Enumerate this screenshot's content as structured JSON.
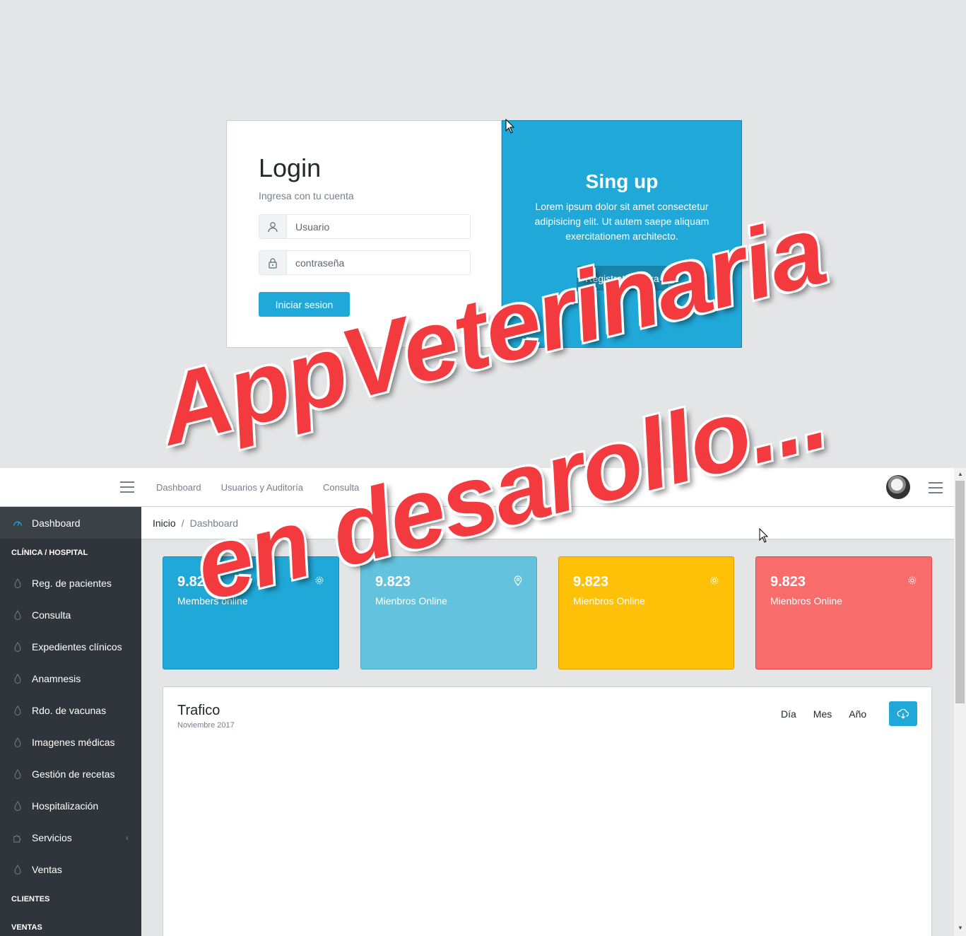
{
  "login": {
    "title": "Login",
    "subtitle": "Ingresa con tu cuenta",
    "username_placeholder": "Usuario",
    "password_placeholder": "contraseña",
    "submit_label": "Iniciar sesion",
    "user_icon": "user-icon",
    "lock_icon": "lock-icon"
  },
  "signup": {
    "title": "Sing up",
    "text": "Lorem ipsum dolor sit amet consectetur adipisicing elit. Ut autem saepe aliquam exercitationem architecto.",
    "button_label": "Registrate Ahora"
  },
  "header": {
    "nav": [
      "Dashboard",
      "Usuarios y Auditoría",
      "Consulta"
    ]
  },
  "sidebar": {
    "items": [
      {
        "type": "item",
        "label": "Dashboard",
        "icon": "speedometer-icon",
        "active": true
      },
      {
        "type": "title",
        "label": "CLÍNICA / HOSPITAL"
      },
      {
        "type": "item",
        "label": "Reg. de pacientes",
        "icon": "drop-icon"
      },
      {
        "type": "item",
        "label": "Consulta",
        "icon": "drop-icon"
      },
      {
        "type": "item",
        "label": "Expedientes clínicos",
        "icon": "drop-icon"
      },
      {
        "type": "item",
        "label": "Anamnesis",
        "icon": "drop-icon"
      },
      {
        "type": "item",
        "label": "Rdo. de vacunas",
        "icon": "drop-icon"
      },
      {
        "type": "item",
        "label": "Imagenes médicas",
        "icon": "drop-icon"
      },
      {
        "type": "item",
        "label": "Gestión de recetas",
        "icon": "drop-icon"
      },
      {
        "type": "item",
        "label": "Hospitalización",
        "icon": "drop-icon"
      },
      {
        "type": "item",
        "label": "Servicios",
        "icon": "puzzle-icon",
        "chevron": "‹"
      },
      {
        "type": "item",
        "label": "Ventas",
        "icon": "drop-icon"
      },
      {
        "type": "title",
        "label": "CLIENTES"
      },
      {
        "type": "title",
        "label": "VENTAS"
      }
    ]
  },
  "breadcrumb": {
    "items": [
      "Inicio",
      "Dashboard"
    ]
  },
  "stats": [
    {
      "value": "9.823",
      "label": "Members online",
      "icon": "gear-icon"
    },
    {
      "value": "9.823",
      "label": "Mienbros Online",
      "icon": "location-pin-icon"
    },
    {
      "value": "9.823",
      "label": "Mienbros Online",
      "icon": "gear-icon"
    },
    {
      "value": "9.823",
      "label": "Mienbros Online",
      "icon": "gear-icon"
    }
  ],
  "traffic": {
    "title": "Trafico",
    "subtitle": "Noviembre 2017",
    "ranges": [
      "Día",
      "Mes",
      "Año"
    ],
    "download_icon": "cloud-download-icon"
  },
  "watermark": {
    "line1": "AppVeterinaria",
    "line2": "en desarollo..."
  },
  "colors": {
    "primary": "#20a8d8",
    "info": "#63c2de",
    "warning": "#ffc107",
    "danger": "#f86c6b",
    "sidebar": "#2f353a",
    "watermark": "#f23a3f"
  }
}
